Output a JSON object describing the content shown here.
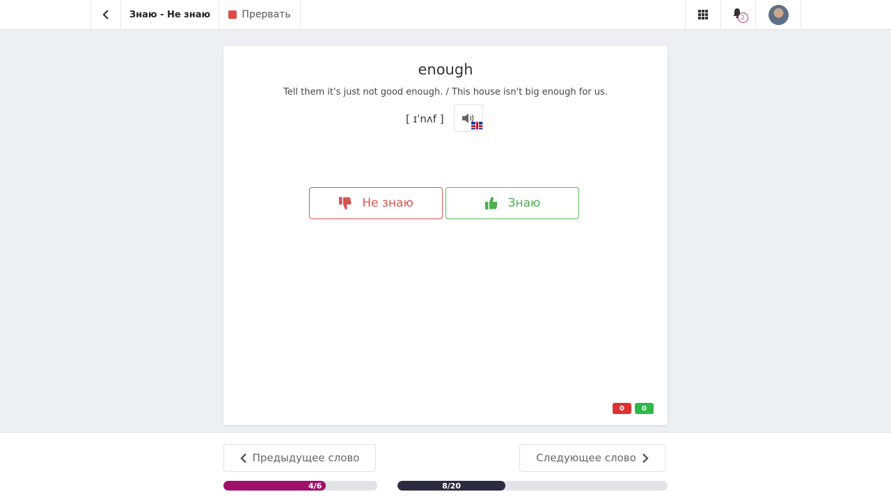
{
  "header": {
    "title": "Знаю - Не знаю",
    "stop_label": "Прервать",
    "notifications_count": "2",
    "icons": [
      "chevron-left-icon",
      "stop-icon",
      "apps-grid-icon",
      "bell-icon",
      "avatar"
    ]
  },
  "card": {
    "word": "enough",
    "example": "Tell them it's just not good enough. / This house isn't big enough for us.",
    "transcription": "[ ɪˈnʌf ]",
    "dont_know_label": "Не знаю",
    "know_label": "Знаю",
    "wrong_count": "0",
    "right_count": "0"
  },
  "footer": {
    "prev_label": "Предыдущее слово",
    "next_label": "Следующее слово",
    "word_progress": {
      "label": "4/6",
      "current": 4,
      "total": 6
    },
    "total_progress": {
      "label": "8/20",
      "current": 8,
      "total": 20
    }
  },
  "colors": {
    "accent_red": "#d9534f",
    "accent_green": "#5cb85c",
    "progress_words": "#a0106a",
    "progress_total": "#2b2b42"
  }
}
